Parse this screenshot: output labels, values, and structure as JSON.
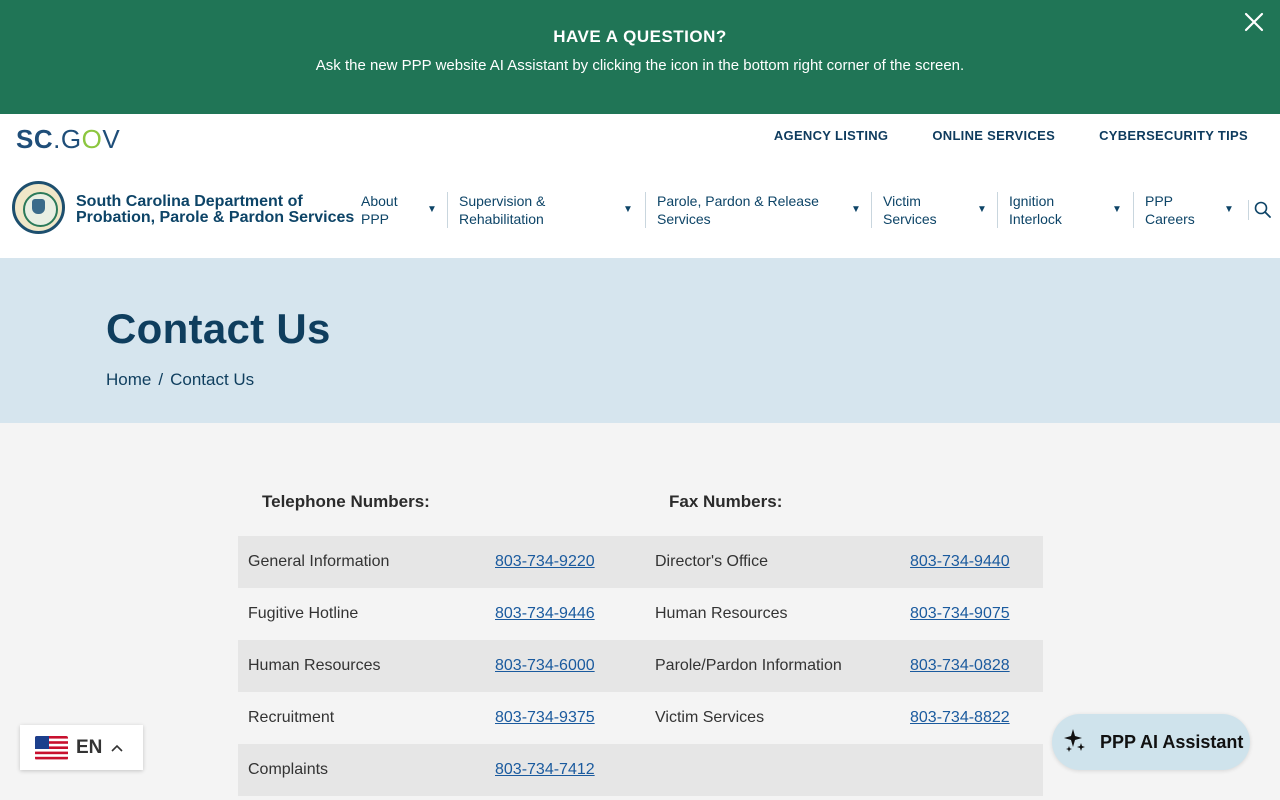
{
  "alert": {
    "title": "HAVE A QUESTION?",
    "text": "Ask the new PPP website AI Assistant by clicking the icon in the bottom right corner of the screen."
  },
  "utility": {
    "logo_sc": "SC",
    "logo_dot_g": ".G",
    "logo_o": "O",
    "logo_v": "V",
    "links": [
      "AGENCY LISTING",
      "ONLINE SERVICES",
      "CYBERSECURITY TIPS"
    ]
  },
  "header": {
    "agency_line1": "South Carolina Department of",
    "agency_line2": "Probation, Parole & Pardon Services",
    "nav": [
      {
        "line1": "About",
        "line2": "PPP"
      },
      {
        "line1": "Supervision &",
        "line2": "Rehabilitation"
      },
      {
        "line1": "Parole, Pardon & Release",
        "line2": "Services"
      },
      {
        "line1": "Victim",
        "line2": "Services"
      },
      {
        "line1": "Ignition",
        "line2": "Interlock"
      },
      {
        "line1": "PPP",
        "line2": "Careers"
      }
    ]
  },
  "hero": {
    "title": "Contact Us",
    "breadcrumb_home": "Home",
    "breadcrumb_sep": "/",
    "breadcrumb_current": "Contact Us"
  },
  "contact": {
    "telephone_heading": "Telephone Numbers:",
    "fax_heading": "Fax Numbers:",
    "rows": [
      {
        "tel_label": "General Information",
        "tel_number": "803-734-9220",
        "fax_label": "Director's Office",
        "fax_number": "803-734-9440"
      },
      {
        "tel_label": "Fugitive Hotline",
        "tel_number": "803-734-9446",
        "fax_label": "Human Resources",
        "fax_number": "803-734-9075"
      },
      {
        "tel_label": "Human Resources",
        "tel_number": "803-734-6000",
        "fax_label": "Parole/Pardon Information",
        "fax_number": "803-734-0828"
      },
      {
        "tel_label": "Recruitment",
        "tel_number": "803-734-9375",
        "fax_label": "Victim Services",
        "fax_number": "803-734-8822"
      },
      {
        "tel_label": "Complaints",
        "tel_number": "803-734-7412",
        "fax_label": "",
        "fax_number": ""
      }
    ]
  },
  "language": {
    "code": "EN"
  },
  "assistant": {
    "label": "PPP AI Assistant"
  },
  "colors": {
    "banner_green": "#207556",
    "navy": "#0d4467",
    "hero_bg": "#d6e5ee",
    "link_blue": "#1a5a9e",
    "row_shade": "#e6e6e6"
  },
  "icons": [
    "close-icon",
    "search-icon",
    "chevron-down-icon",
    "us-flag-icon",
    "chevron-up-icon",
    "sparkle-icon",
    "agency-seal-logo"
  ]
}
